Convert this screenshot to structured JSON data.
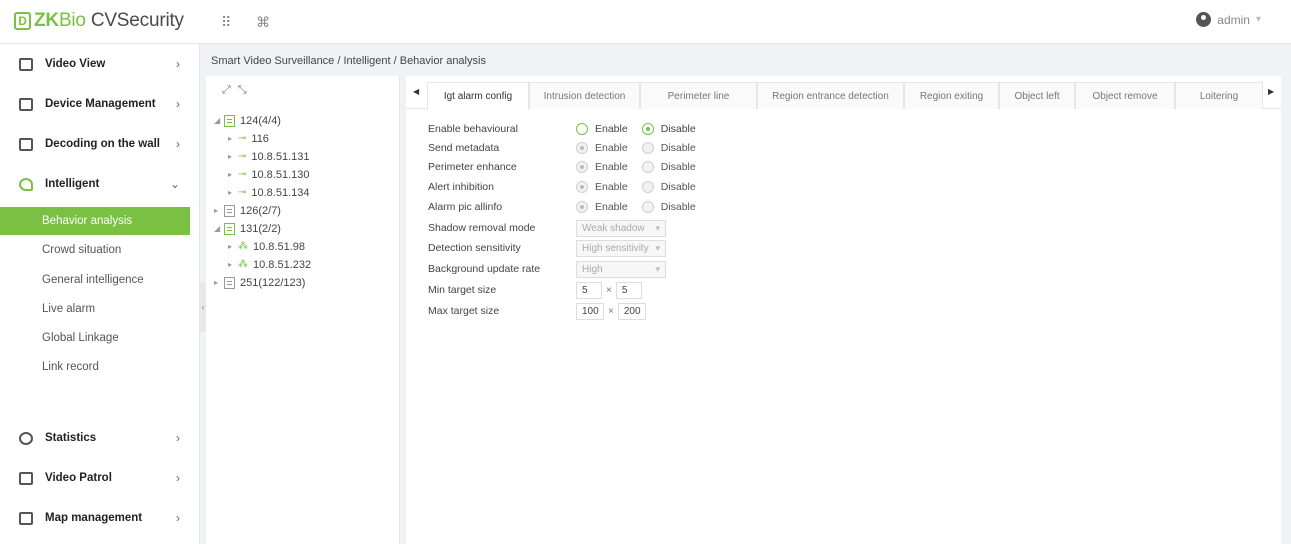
{
  "app": {
    "logo_box": "D",
    "logo_zk": "ZK",
    "logo_bio": "Bio",
    "logo_rest": "CVSecurity",
    "grid_icon": "grid-icon",
    "command_icon": "command-icon",
    "user_name": "admin",
    "user_caret": "▾"
  },
  "sidebar": {
    "main_items": [
      {
        "label": "Video View",
        "icon": "video-view-icon",
        "chevron": "›"
      },
      {
        "label": "Device Management",
        "icon": "device-icon",
        "chevron": "›"
      },
      {
        "label": "Decoding on the wall",
        "icon": "decoding-icon",
        "chevron": "›"
      },
      {
        "label": "Intelligent",
        "icon": "intelligent-icon",
        "chevron": "⌄"
      },
      {
        "label": "Statistics",
        "icon": "statistics-icon",
        "chevron": "›"
      },
      {
        "label": "Video Patrol",
        "icon": "patrol-icon",
        "chevron": "›"
      },
      {
        "label": "Map management",
        "icon": "map-icon",
        "chevron": "›"
      }
    ],
    "sub_items": [
      {
        "label": "Behavior analysis",
        "active": true
      },
      {
        "label": "Crowd situation"
      },
      {
        "label": "General intelligence"
      },
      {
        "label": "Live alarm"
      },
      {
        "label": "Global Linkage"
      },
      {
        "label": "Link record"
      }
    ]
  },
  "breadcrumb": "Smart Video Surveillance / Intelligent / Behavior analysis",
  "tree": {
    "nodes": [
      {
        "label": "124(4/4)",
        "type": "box",
        "expanded": true
      },
      {
        "label": "116",
        "type": "camera"
      },
      {
        "label": "10.8.51.131",
        "type": "camera"
      },
      {
        "label": "10.8.51.130",
        "type": "camera"
      },
      {
        "label": "10.8.51.134",
        "type": "camera"
      },
      {
        "label": "126(2/7)",
        "type": "box-grey"
      },
      {
        "label": "131(2/2)",
        "type": "box",
        "expanded": true
      },
      {
        "label": "10.8.51.98",
        "type": "camera-alt"
      },
      {
        "label": "10.8.51.232",
        "type": "camera-alt"
      },
      {
        "label": "251(122/123)",
        "type": "box-grey"
      }
    ]
  },
  "tabs": [
    {
      "label": "Igt alarm config",
      "active": true
    },
    {
      "label": "Intrusion detection"
    },
    {
      "label": "Perimeter line"
    },
    {
      "label": "Region entrance detection"
    },
    {
      "label": "Region exiting"
    },
    {
      "label": "Object left"
    },
    {
      "label": "Object remove"
    },
    {
      "label": "Loitering"
    }
  ],
  "form": {
    "enable_label": "Enable",
    "disable_label": "Disable",
    "radios": [
      {
        "label": "Enable behavioural",
        "selected": "disable",
        "enabled": true
      },
      {
        "label": "Send metadata",
        "selected": "enable",
        "enabled": false
      },
      {
        "label": "Perimeter enhance",
        "selected": "enable",
        "enabled": false
      },
      {
        "label": "Alert inhibition",
        "selected": "enable",
        "enabled": false
      },
      {
        "label": "Alarm pic allinfo",
        "selected": "enable",
        "enabled": false
      }
    ],
    "selects": [
      {
        "label": "Shadow removal mode",
        "value": "Weak shadow"
      },
      {
        "label": "Detection sensitivity",
        "value": "High sensitivity"
      },
      {
        "label": "Background update rate",
        "value": "High"
      }
    ],
    "min_target": {
      "label": "Min target size",
      "w": "5",
      "h": "5"
    },
    "max_target": {
      "label": "Max target size",
      "w": "100",
      "h": "200"
    },
    "times": "×"
  }
}
